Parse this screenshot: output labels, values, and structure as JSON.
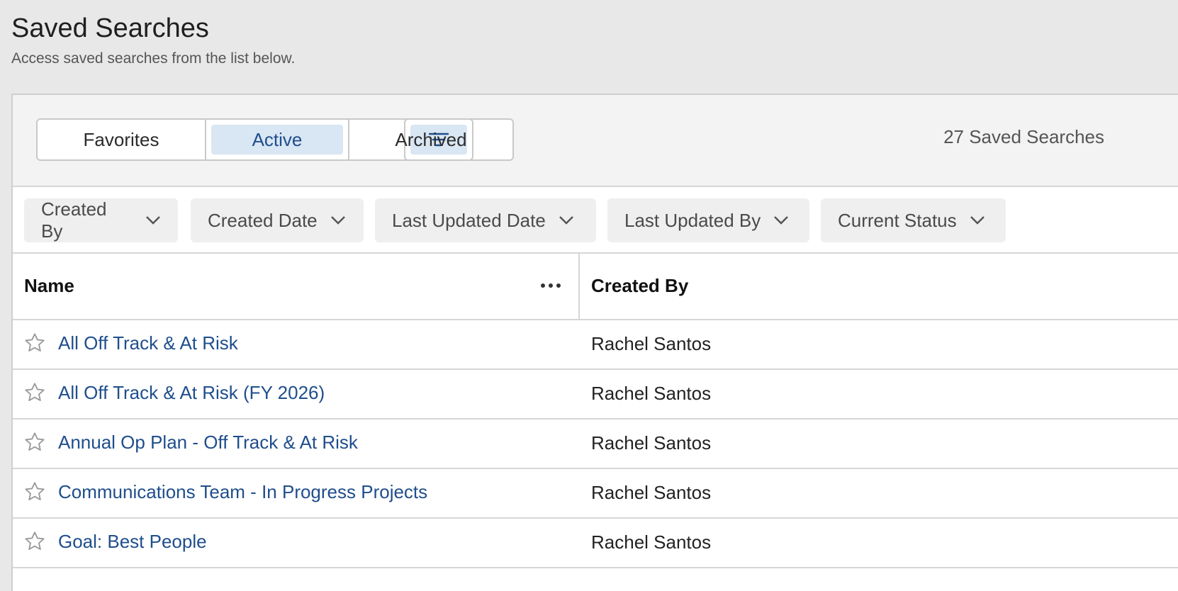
{
  "page": {
    "title": "Saved Searches",
    "subtitle": "Access saved searches from the list below."
  },
  "toolbar": {
    "tabs": [
      {
        "label": "Favorites",
        "active": false
      },
      {
        "label": "Active",
        "active": true
      },
      {
        "label": "Archived",
        "active": false
      }
    ],
    "filter_icon": "filter-lines-icon",
    "count_label": "27 Saved Searches"
  },
  "filters": [
    {
      "label": "Created By",
      "icon": "chevron-down-icon"
    },
    {
      "label": "Created Date",
      "icon": "chevron-down-icon"
    },
    {
      "label": "Last Updated Date",
      "icon": "chevron-down-icon"
    },
    {
      "label": "Last Updated By",
      "icon": "chevron-down-icon"
    },
    {
      "label": "Current Status",
      "icon": "chevron-down-icon"
    }
  ],
  "table": {
    "columns": [
      {
        "label": "Name",
        "menu_icon": "more-horizontal-icon"
      },
      {
        "label": "Created By"
      }
    ],
    "rows": [
      {
        "name": "All Off Track & At Risk",
        "created_by": "Rachel Santos",
        "favorite": false
      },
      {
        "name": "All Off Track & At Risk (FY 2026)",
        "created_by": "Rachel Santos",
        "favorite": false
      },
      {
        "name": "Annual Op Plan - Off Track & At Risk",
        "created_by": "Rachel Santos",
        "favorite": false
      },
      {
        "name": "Communications Team - In Progress Projects",
        "created_by": "Rachel Santos",
        "favorite": false
      },
      {
        "name": "Goal: Best People",
        "created_by": "Rachel Santos",
        "favorite": false
      }
    ]
  },
  "colors": {
    "link": "#1f4e8c",
    "active_bg": "#d9e6f3",
    "page_bg": "#e8e8e8"
  }
}
